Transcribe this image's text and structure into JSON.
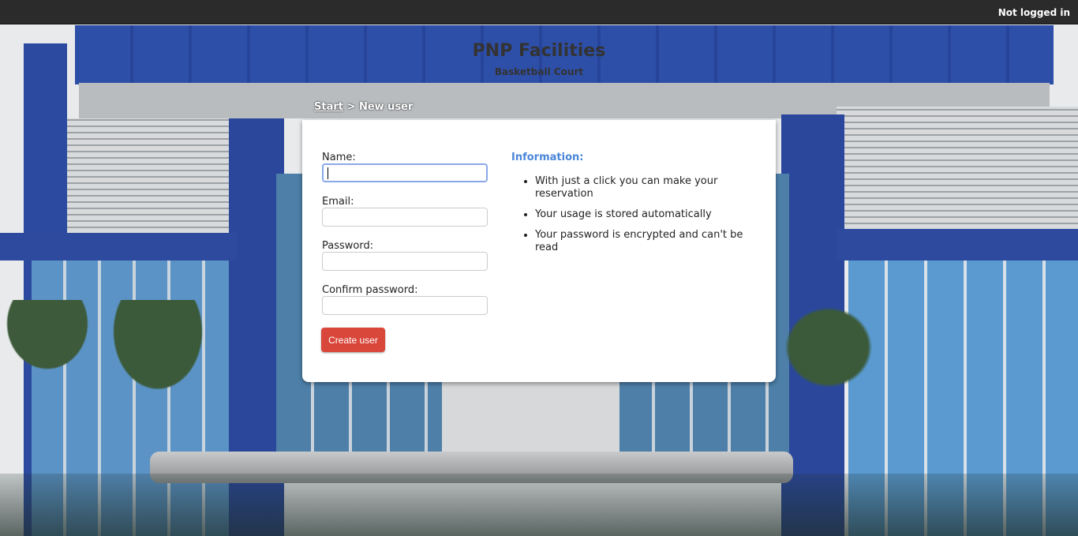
{
  "topbar": {
    "status": "Not logged in"
  },
  "header": {
    "title": "PNP Facilities",
    "subtitle": "Basketball Court"
  },
  "breadcrumb": {
    "start": "Start",
    "separator": ">",
    "current": "New user"
  },
  "form": {
    "name_label": "Name:",
    "name_value": "",
    "email_label": "Email:",
    "email_value": "",
    "password_label": "Password:",
    "password_value": "",
    "confirm_label": "Confirm password:",
    "confirm_value": "",
    "submit_label": "Create user"
  },
  "info": {
    "heading": "Information:",
    "items": [
      "With just a click you can make your reservation",
      "Your usage is stored automatically",
      "Your password is encrypted and can't be read"
    ]
  },
  "colors": {
    "accent": "#4a86d8",
    "button": "#d9463a",
    "topbar": "#2b2b2b"
  }
}
